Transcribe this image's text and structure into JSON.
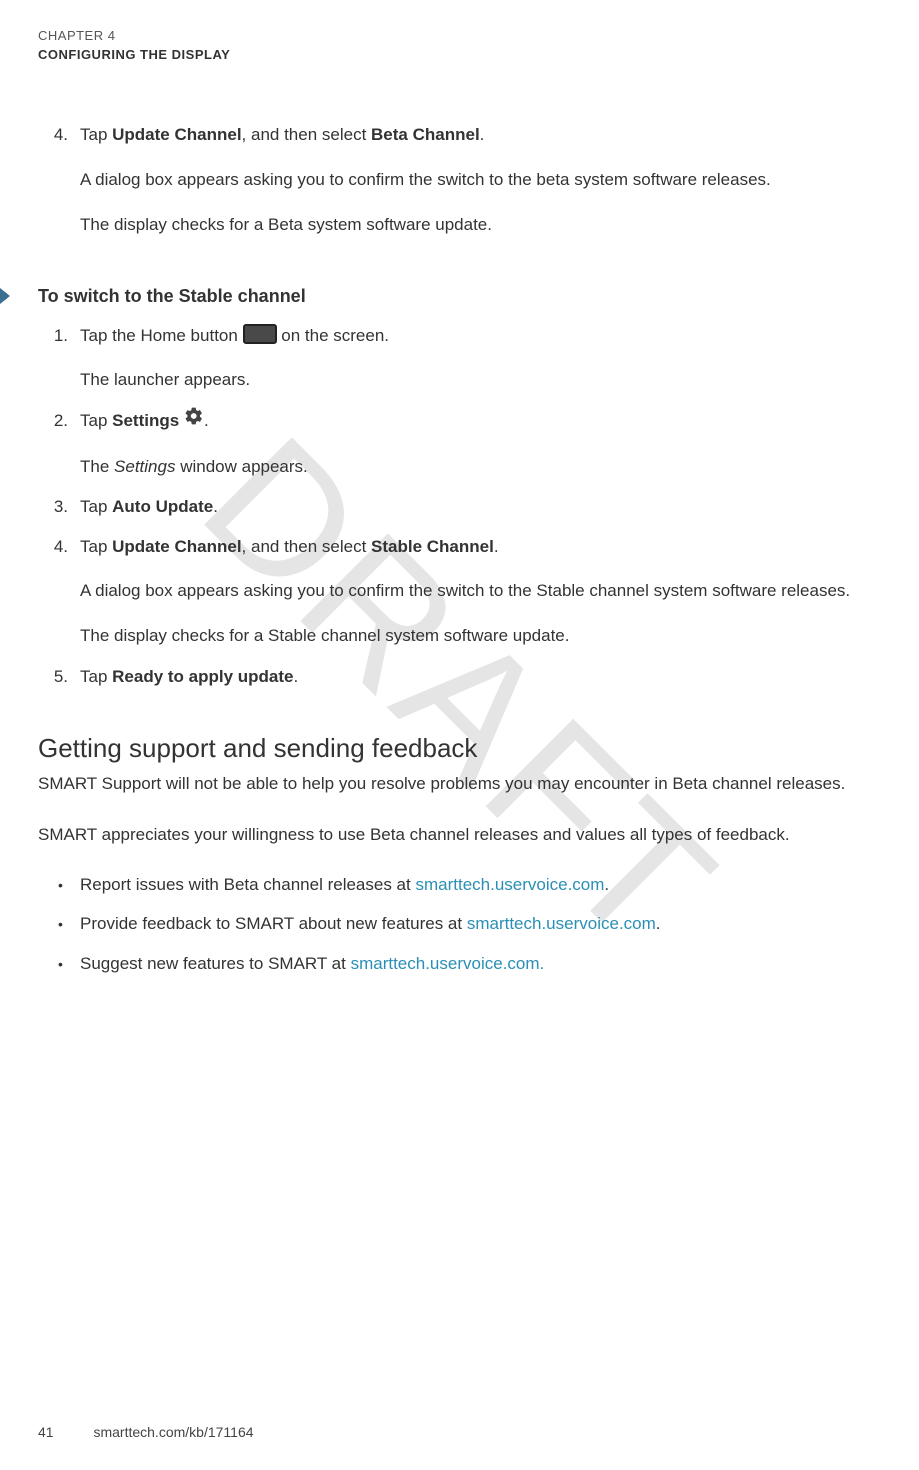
{
  "watermark": "DRAFT",
  "header": {
    "chapter_label": "CHAPTER 4",
    "chapter_title": "CONFIGURING THE DISPLAY"
  },
  "step4_prefix": "Tap ",
  "step4_bold1": "Update Channel",
  "step4_mid": ", and then select ",
  "step4_bold2": "Beta Channel",
  "step4_suffix": ".",
  "step4_p1": "A dialog box appears asking you to confirm the switch to the beta system software releases.",
  "step4_p2": "The display checks for a Beta system software update.",
  "section_stable": "To switch to the Stable channel",
  "s1_a": "Tap the Home button ",
  "s1_b": " on the screen.",
  "s1_p": "The launcher appears.",
  "s2_a": "Tap ",
  "s2_bold": "Settings",
  "s2_b": " ",
  "s2_c": ".",
  "s2_p_a": "The ",
  "s2_p_i": "Settings",
  "s2_p_b": " window appears.",
  "s3_a": "Tap ",
  "s3_bold": "Auto Update",
  "s3_b": ".",
  "s4_a": "Tap ",
  "s4_bold1": "Update Channel",
  "s4_mid": ", and then select ",
  "s4_bold2": "Stable Channel",
  "s4_b": ".",
  "s4_p1": "A dialog box appears asking you to confirm the switch to the Stable channel system software releases.",
  "s4_p2": "The display checks for a Stable channel system software update.",
  "s5_a": "Tap ",
  "s5_bold": "Ready to apply update",
  "s5_b": ".",
  "h2": "Getting support and sending feedback",
  "body1": "SMART Support will not be able to help you resolve problems you may encounter in Beta channel releases.",
  "body2": "SMART appreciates your willingness to use Beta channel releases and values all types of feedback.",
  "b1_a": "Report issues with Beta channel releases at ",
  "b1_link": "smarttech.uservoice.com",
  "b1_b": ".",
  "b2_a": "Provide feedback to SMART about new features at ",
  "b2_link": "smarttech.uservoice.com",
  "b2_b": ".",
  "b3_a": "Suggest new features to SMART at ",
  "b3_link": "smarttech.uservoice.com.",
  "footer": {
    "page": "41",
    "url": "smarttech.com/kb/171164"
  },
  "nums": {
    "n1": "1.",
    "n2": "2.",
    "n3": "3.",
    "n4": "4.",
    "n5": "5."
  }
}
